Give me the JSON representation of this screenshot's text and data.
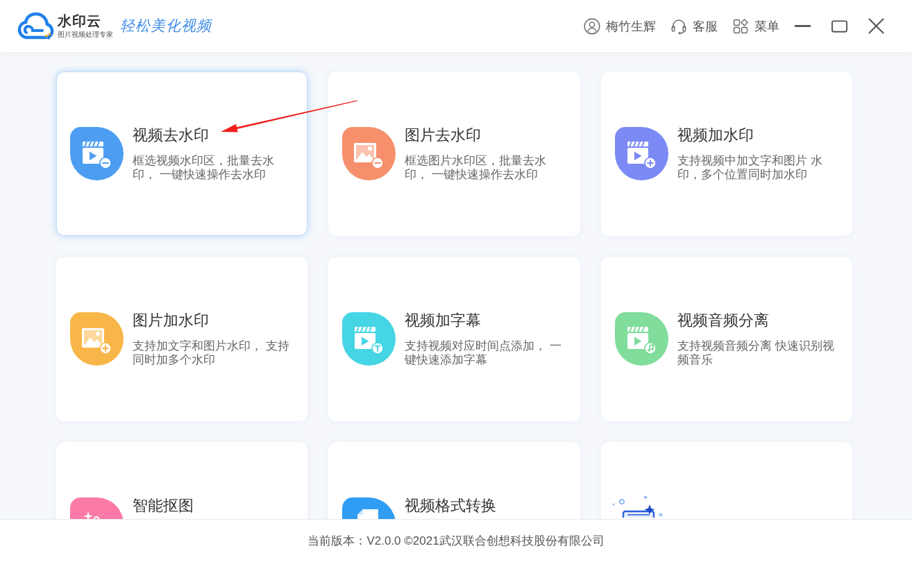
{
  "header": {
    "logo": {
      "name": "水印云",
      "tagline": "图片视频处理专家"
    },
    "slogan": "轻松美化视频",
    "actions": [
      {
        "kind": "user",
        "label": "梅竹生辉"
      },
      {
        "kind": "support",
        "label": "客服"
      },
      {
        "kind": "menu",
        "label": "菜单"
      }
    ]
  },
  "tools": [
    {
      "kind": "tool",
      "title": "视频去水印",
      "description": "框选视频水印区，批量去水印， 一键快速操作去水印",
      "color": "#4d9ef2",
      "selected": true
    },
    {
      "kind": "tool",
      "title": "图片去水印",
      "description": "框选图片水印区，批量去水印， 一键快速操作去水印",
      "color": "#f6906c",
      "selected": false
    },
    {
      "kind": "tool",
      "title": "视频加水印",
      "description": "支持视频中加文字和图片 水印，多个位置同时加水印",
      "color": "#7b8af5",
      "selected": false
    },
    {
      "kind": "tool",
      "title": "图片加水印",
      "description": "支持加文字和图片水印， 支持同时加多个水印",
      "color": "#f9b648",
      "selected": false
    },
    {
      "kind": "tool",
      "title": "视频加字幕",
      "description": "支持视频对应时间点添加， 一键快速添加字幕",
      "color": "#45d5e4",
      "selected": false
    },
    {
      "kind": "tool",
      "title": "视频音频分离",
      "description": "支持视频音频分离 快速识别视频音乐",
      "color": "#80dd9c",
      "selected": false
    },
    {
      "kind": "tool",
      "title": "智能抠图",
      "color": "#fb7aa8",
      "selected": false
    },
    {
      "kind": "tool",
      "title": "视频格式转换",
      "color": "#2f9df3",
      "selected": false
    },
    {
      "kind": "illustration",
      "selected": false
    }
  ],
  "footer": {
    "text": "当前版本：V2.0.0 ©2021武汉联合创想科技股份有限公司"
  }
}
